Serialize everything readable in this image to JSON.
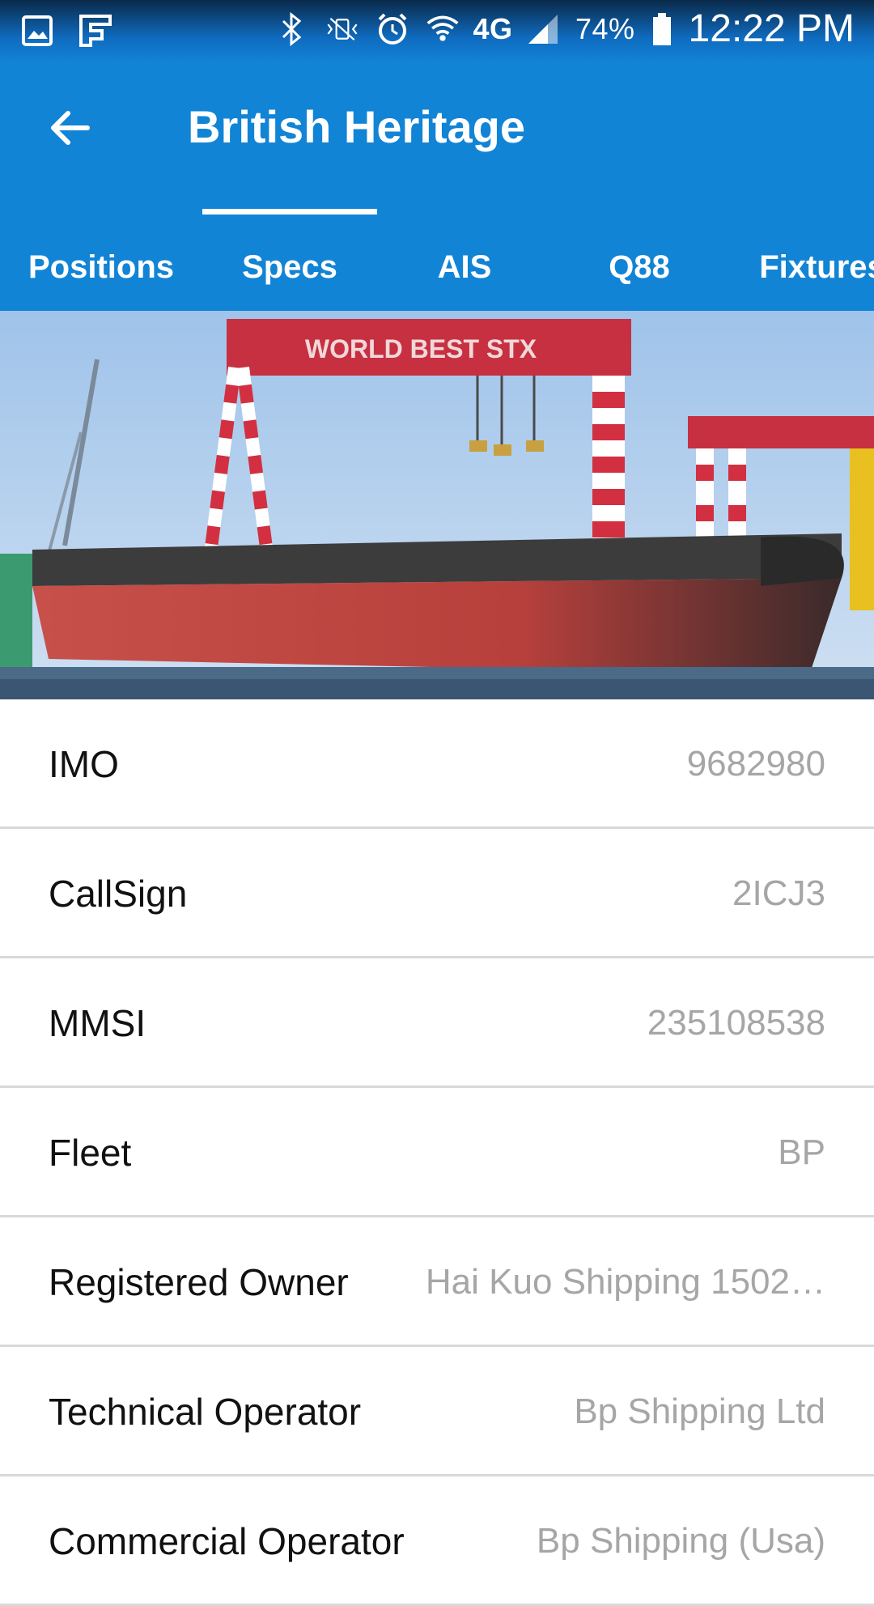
{
  "status_bar": {
    "battery": "74%",
    "time": "12:22 PM",
    "network": "4G",
    "icons": [
      "gallery-icon",
      "flipboard-icon",
      "bluetooth-icon",
      "vibrate-icon",
      "alarm-icon",
      "wifi-icon",
      "4g-lte-icon",
      "signal-icon",
      "battery-icon"
    ]
  },
  "app_bar": {
    "title": "British Heritage",
    "back_icon": "arrow-left-icon"
  },
  "tabs": [
    {
      "label": "Positions",
      "active": false
    },
    {
      "label": "Specs",
      "active": true
    },
    {
      "label": "AIS",
      "active": false
    },
    {
      "label": "Q88",
      "active": false
    },
    {
      "label": "Fixtures",
      "active": false
    }
  ],
  "hero": {
    "crane_text": "WORLD BEST STX"
  },
  "specs": [
    {
      "label": "IMO",
      "value": "9682980"
    },
    {
      "label": "CallSign",
      "value": "2ICJ3"
    },
    {
      "label": "MMSI",
      "value": "235108538"
    },
    {
      "label": "Fleet",
      "value": "BP"
    },
    {
      "label": "Registered Owner",
      "value": "Hai Kuo Shipping 1502…"
    },
    {
      "label": "Technical Operator",
      "value": "Bp Shipping Ltd"
    },
    {
      "label": "Commercial Operator",
      "value": "Bp Shipping (Usa)"
    }
  ],
  "colors": {
    "primary": "#1284d6",
    "label_text": "#111111",
    "value_text": "#a6a6a6",
    "divider": "#d9d9d9"
  }
}
